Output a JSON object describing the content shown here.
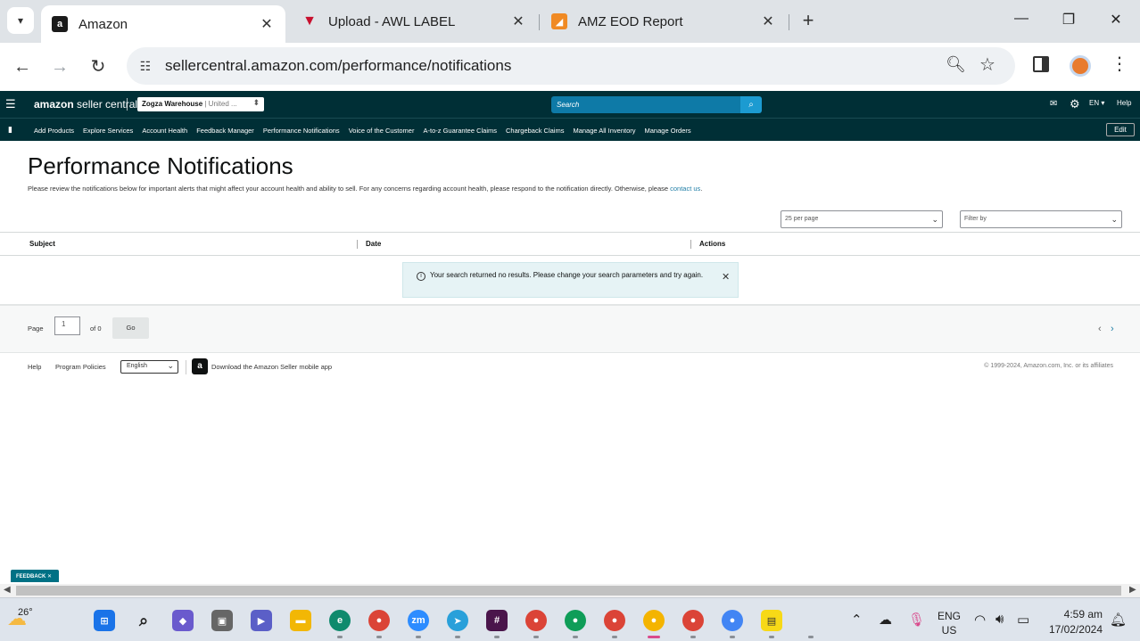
{
  "browser": {
    "tabs": [
      {
        "title": "Amazon",
        "active": true,
        "favicon_color": "#1a1a1a"
      },
      {
        "title": "Upload - AWL LABEL",
        "active": false,
        "favicon_color": "#c8102e"
      },
      {
        "title": "AMZ EOD Report",
        "active": false,
        "favicon_color": "#f08a24"
      }
    ],
    "url": "sellercentral.amazon.com/performance/notifications"
  },
  "seller_header": {
    "logo_bold": "amazon",
    "logo_rest": " seller central",
    "store_name": "Zogza Warehouse",
    "store_region": " | United ...",
    "search_placeholder": "Search",
    "language": "EN",
    "help": "Help"
  },
  "nav": {
    "items": [
      "Add Products",
      "Explore Services",
      "Account Health",
      "Feedback Manager",
      "Performance Notifications",
      "Voice of the Customer",
      "A-to-z Guarantee Claims",
      "Chargeback Claims",
      "Manage All Inventory",
      "Manage Orders"
    ],
    "edit": "Edit"
  },
  "page": {
    "title": "Performance Notifications",
    "description": "Please review the notifications below for important alerts that might affect your account health and ability to sell. For any concerns regarding account health, please respond to the notification directly. Otherwise, please ",
    "contact_link": "contact us",
    "description_end": "."
  },
  "controls": {
    "per_page": "25 per page",
    "filter_by": "Filter by"
  },
  "table": {
    "columns": [
      "Subject",
      "Date",
      "Actions"
    ]
  },
  "alert": {
    "message": "Your search returned no results. Please change your search parameters and try again."
  },
  "pager": {
    "page_label": "Page",
    "current_page": "1",
    "of_label": "of 0",
    "go_label": "Go"
  },
  "footer": {
    "help": "Help",
    "policies": "Program Policies",
    "language": "English",
    "app_text": "Download the Amazon Seller mobile app",
    "copyright": "© 1999-2024, Amazon.com, Inc. or its affiliates"
  },
  "feedback": "FEEDBACK",
  "taskbar": {
    "temperature": "26°",
    "lang_line1": "ENG",
    "lang_line2": "US",
    "time": "4:59 am",
    "date": "17/02/2024"
  }
}
